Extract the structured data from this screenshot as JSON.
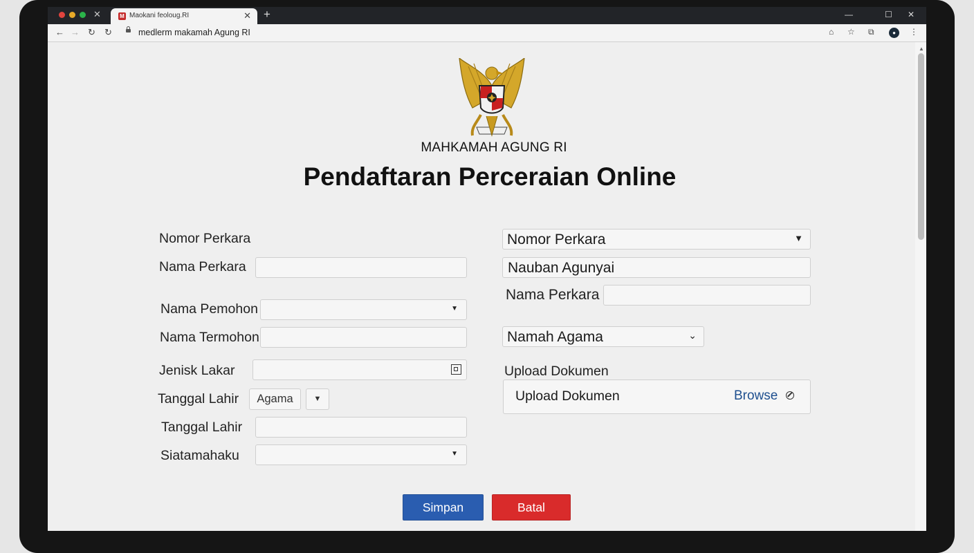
{
  "browser": {
    "tab_title": "Maokani feoloug.RI",
    "favicon_letter": "M",
    "url": "medlerm makamah Agung RI"
  },
  "header": {
    "institution": "MAHKAMAH AGUNG RI",
    "title": "Pendaftaran Perceraian Online"
  },
  "left_form": {
    "nomor_perkara_label": "Nomor Perkara",
    "nama_perkara_label": "Nama Perkara",
    "nama_pemohon_label": "Nama Pemohon",
    "nama_termohon_label": "Nama Termohon",
    "jenisk_lakar_label": "Jenisk Lakar",
    "tanggal_lahir_label_1": "Tanggal Lahir",
    "agama_value": "Agama",
    "tanggal_lahir_label_2": "Tanggal Lahir",
    "siatamahaku_label": "Siatamahaku"
  },
  "right_form": {
    "nomor_perkara_select": "Nomor Perkara",
    "nauban_field_value": "Nauban Agunyai",
    "nama_perkara_label": "Nama Perkara",
    "namah_agama_select": "Namah Agama",
    "upload_label": "Upload Dokumen",
    "upload_field_text": "Upload Dokumen",
    "browse_label": "Browse"
  },
  "actions": {
    "save_label": "Simpan",
    "cancel_label": "Batal",
    "save_color": "#2a5db0",
    "cancel_color": "#d92b2b"
  },
  "icons": {
    "back": "arrow-left-icon",
    "forward": "arrow-right-icon",
    "reload": "reload-icon",
    "lock": "lock-icon",
    "bookmark": "star-icon",
    "calendar": "calendar-icon",
    "browse": "clear-icon"
  }
}
